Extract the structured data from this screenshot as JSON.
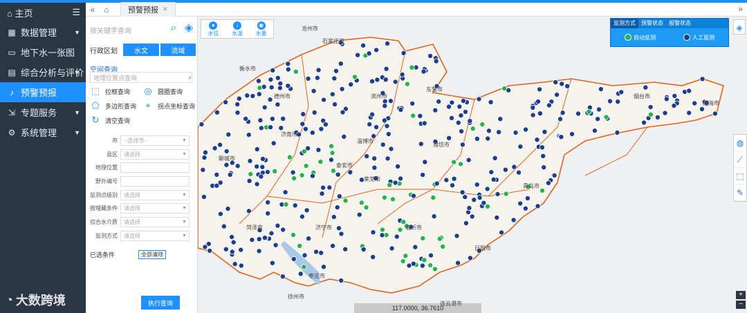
{
  "nav": {
    "home": "主页",
    "items": [
      {
        "icon": "grid-icon",
        "label": "数据管理",
        "caret": "▼"
      },
      {
        "icon": "map-icon",
        "label": "地下水一张图",
        "caret": ""
      },
      {
        "icon": "chart-icon",
        "label": "综合分析与评价",
        "caret": "▼"
      },
      {
        "icon": "bell-icon",
        "label": "预警预报",
        "caret": ""
      },
      {
        "icon": "export-icon",
        "label": "专题服务",
        "caret": "▼"
      },
      {
        "icon": "gear-icon",
        "label": "系统管理",
        "caret": "▼"
      }
    ],
    "watermark": "大数跨境"
  },
  "tabbar": {
    "prev": "«",
    "home_icon": "⌂",
    "tab_label": "预警预报",
    "next": "»"
  },
  "panel": {
    "search_placeholder": "按关键字查询",
    "district_label": "行政区划",
    "tabs": [
      "水文",
      "流域"
    ],
    "space_query": "空间查询",
    "pos_placeholder": "地理位置点查询",
    "queries": [
      "拉框查询",
      "圆圈查询",
      "多边形查询",
      "拐点坐标查询",
      "清空查询"
    ],
    "form": [
      {
        "label": "市",
        "value": "--选择市--",
        "select": true
      },
      {
        "label": "县区",
        "value": "请选择",
        "select": true
      },
      {
        "label": "地理位置",
        "value": "",
        "select": false
      },
      {
        "label": "野外编号",
        "value": "",
        "select": false
      },
      {
        "label": "监测点级别",
        "value": "请选择",
        "select": true
      },
      {
        "label": "按埋藏条件",
        "value": "请选择",
        "select": true
      },
      {
        "label": "综合水介质",
        "value": "请选择",
        "select": true
      },
      {
        "label": "监测方式",
        "value": "请选择",
        "select": true
      }
    ],
    "selected_conditions": "已选条件",
    "clear_all": "全部清除",
    "execute": "执行查询"
  },
  "map": {
    "layers": [
      "水位",
      "水温",
      "水量"
    ],
    "legend_tabs": [
      "监测方式",
      "预警状态",
      "报警状态"
    ],
    "legend_items": [
      "自动监测",
      "人工监测"
    ],
    "coordinates": "117.0000, 36.7610",
    "zoom_in": "+",
    "zoom_out": "−",
    "cities": [
      "石家庄市",
      "衡水市",
      "德州市",
      "沧州市",
      "东营市",
      "济南市",
      "淄博市",
      "潍坊市",
      "青岛市",
      "日照市",
      "临沂市",
      "泰安市",
      "济宁市",
      "菏泽市",
      "枣庄市",
      "徐州市",
      "连云港市",
      "烟台市",
      "威海市",
      "聊城市",
      "滨州市",
      "莱芜市"
    ],
    "colors": {
      "auto": "#23b54a",
      "manual": "#1a3f8f",
      "boundary": "#e0641c"
    }
  }
}
